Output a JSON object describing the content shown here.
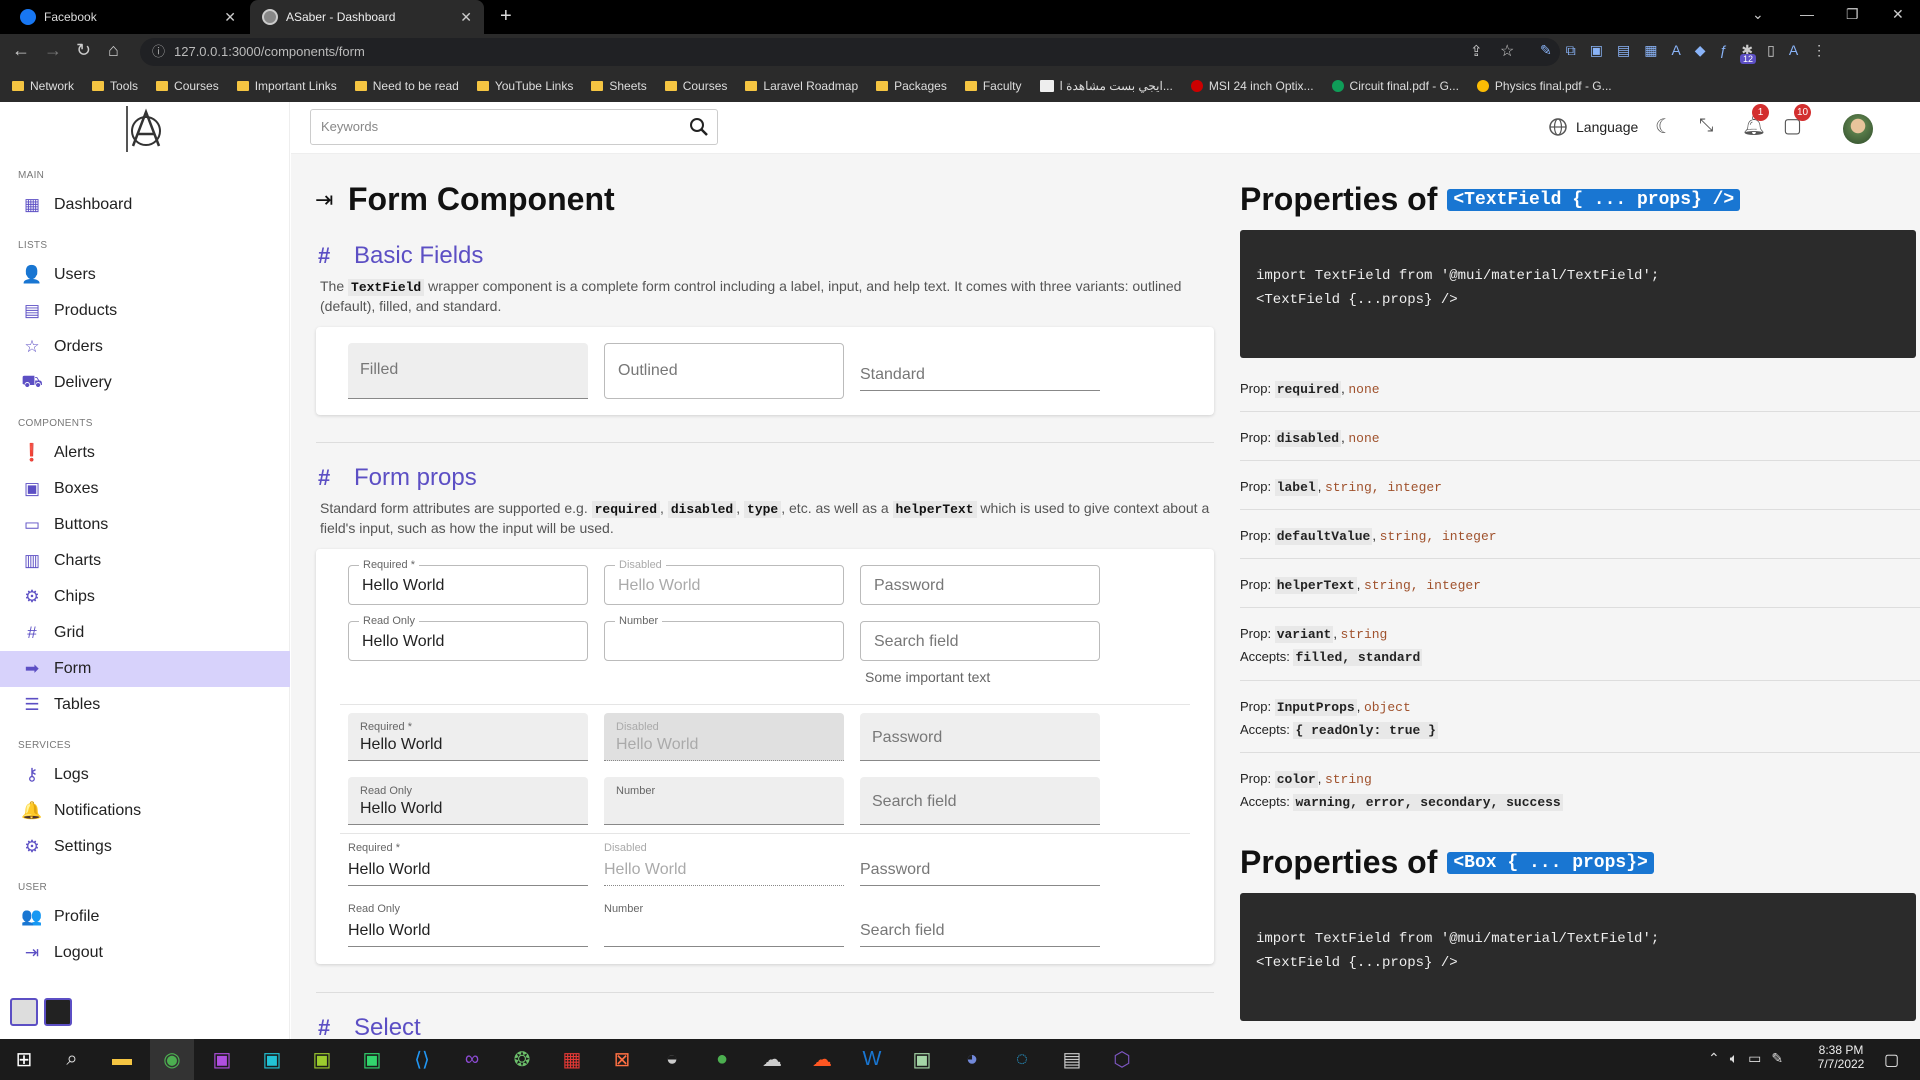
{
  "browser": {
    "tabs": [
      {
        "label": "Facebook"
      },
      {
        "label": "ASaber - Dashboard"
      }
    ],
    "url": "127.0.0.1:3000/components/form",
    "bookmarks": [
      "Network",
      "Tools",
      "Courses",
      "Important Links",
      "Need to be read",
      "YouTube Links",
      "Sheets",
      "Courses",
      "Laravel Roadmap",
      "Packages",
      "Faculty",
      "ايجي بست مشاهدة ا...",
      "MSI 24 inch Optix...",
      "Circuit final.pdf - G...",
      "Physics final.pdf - G..."
    ],
    "ext_badge": "12"
  },
  "app": {
    "search_placeholder": "Keywords",
    "language_label": "Language",
    "notif_count": "1",
    "msg_count": "10",
    "sidebar": {
      "sections": {
        "main": "MAIN",
        "lists": "LISTS",
        "components": "COMPONENTS",
        "services": "SERVICES",
        "user": "USER"
      },
      "items": [
        "Dashboard",
        "Users",
        "Products",
        "Orders",
        "Delivery",
        "Alerts",
        "Boxes",
        "Buttons",
        "Charts",
        "Chips",
        "Grid",
        "Form",
        "Tables",
        "Logs",
        "Notifications",
        "Settings",
        "Profile",
        "Logout"
      ]
    },
    "page_title": "Form Component",
    "basic": {
      "title": "Basic Fields",
      "desc_a": "The ",
      "code": "TextField",
      "desc_b": " wrapper component is a complete form control including a label, input, and help text. It comes with three variants: outlined (default), filled, and standard.",
      "filled": "Filled",
      "outlined": "Outlined",
      "standard": "Standard"
    },
    "props": {
      "title": "Form props",
      "desc_a": "Standard form attributes are supported e.g. ",
      "c1": "required",
      "c2": "disabled",
      "c3": "type",
      "desc_b": ", etc. as well as a ",
      "c4": "helperText",
      "desc_c": " which is used to give context about a field's input, such as how the input will be used.",
      "required_label": "Required *",
      "disabled_label": "Disabled",
      "readonly_label": "Read Only",
      "number_label": "Number",
      "value": "Hello World",
      "password": "Password",
      "search": "Search field",
      "helper": "Some important text"
    },
    "select_title": "Select",
    "right": {
      "title1": "Properties of",
      "pill1": "<TextField { ... props} />",
      "code_line1": "import TextField from '@mui/material/TextField';",
      "code_line2": "<TextField {...props} />",
      "props": [
        {
          "name": "required",
          "type": "none",
          "accepts": ""
        },
        {
          "name": "disabled",
          "type": "none",
          "accepts": ""
        },
        {
          "name": "label",
          "type": "string, integer",
          "accepts": ""
        },
        {
          "name": "defaultValue",
          "type": "string, integer",
          "accepts": ""
        },
        {
          "name": "helperText",
          "type": "string, integer",
          "accepts": ""
        },
        {
          "name": "variant",
          "type": "string",
          "accepts": "filled, standard"
        },
        {
          "name": "InputProps",
          "type": "object",
          "accepts": "{ readOnly: true }"
        },
        {
          "name": "color",
          "type": "string",
          "accepts": "warning, error, secondary, success"
        }
      ],
      "prop_label": "Prop:",
      "accepts_label": "Accepts:",
      "title2": "Properties of",
      "pill2": "<Box { ... props}>"
    }
  },
  "taskbar": {
    "time": "8:38 PM",
    "date": "7/7/2022"
  },
  "colors": {
    "accent": "#5c4fc4",
    "active_bg": "#d7d2fb",
    "pill": "#1976d2"
  }
}
